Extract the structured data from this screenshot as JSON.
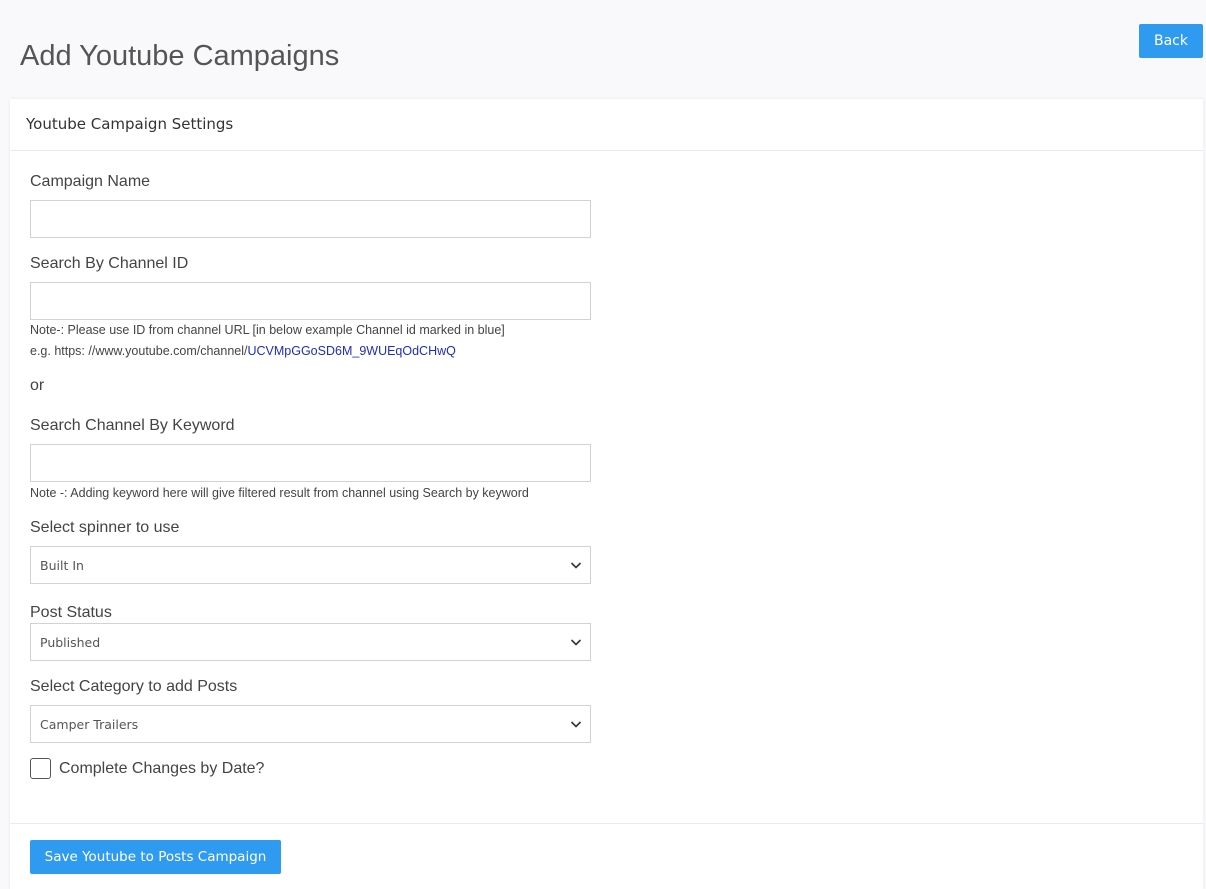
{
  "page": {
    "title": "Add Youtube Campaigns",
    "back_label": "Back"
  },
  "card": {
    "header_title": "Youtube Campaign Settings"
  },
  "form": {
    "campaign_name": {
      "label": "Campaign Name",
      "value": ""
    },
    "channel_id": {
      "label": "Search By Channel ID",
      "value": "",
      "note_line1": "Note-: Please use ID from channel URL [in below example Channel id marked in blue]",
      "note_line2_prefix": "e.g. https: //www.youtube.com/channel/",
      "note_line2_id": "UCVMpGGoSD6M_9WUEqOdCHwQ"
    },
    "or_text": "or",
    "keyword": {
      "label": "Search Channel By Keyword",
      "value": "",
      "note": "Note -: Adding keyword here will give filtered result from channel using Search by keyword"
    },
    "spinner": {
      "label": "Select spinner to use",
      "selected": "Built In"
    },
    "post_status": {
      "label": "Post Status",
      "selected": "Published"
    },
    "category": {
      "label": "Select Category to add Posts",
      "selected": "Camper Trailers"
    },
    "complete_changes": {
      "label": "Complete Changes by Date?",
      "checked": false
    }
  },
  "footer": {
    "save_label": "Save Youtube to Posts Campaign"
  },
  "colors": {
    "accent": "#2f9bf0",
    "link_blue": "#1f2dbd",
    "border": "#cfd3d8",
    "page_bg": "#f9f9fb"
  },
  "icons": {
    "dropdown": "chevron-down-icon"
  }
}
